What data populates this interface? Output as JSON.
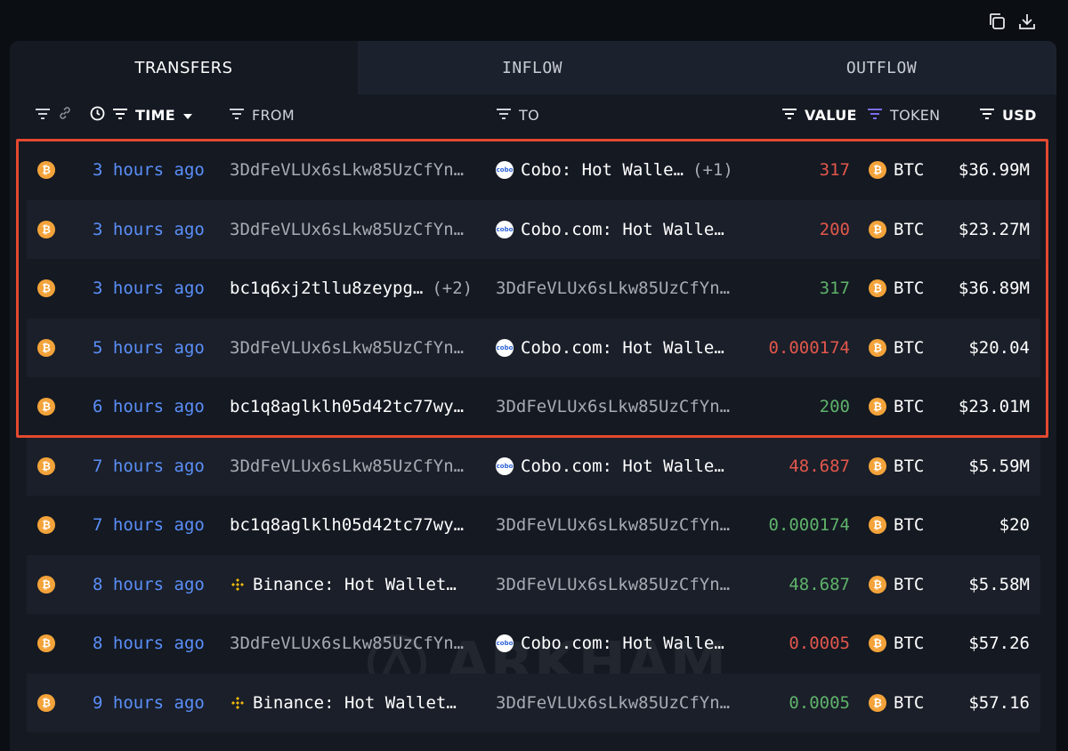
{
  "toolbar": {
    "copy_icon": "copy-icon",
    "download_icon": "download-icon"
  },
  "tabs": [
    {
      "label": "TRANSFERS",
      "active": true
    },
    {
      "label": "INFLOW",
      "active": false
    },
    {
      "label": "OUTFLOW",
      "active": false
    }
  ],
  "columns": {
    "time": "TIME",
    "from": "FROM",
    "to": "TO",
    "value": "VALUE",
    "token": "TOKEN",
    "usd": "USD"
  },
  "rows": [
    {
      "time": "3 hours ago",
      "from": "3DdFeVLUx6sLkw85UzCfYn…",
      "from_type": "address",
      "to": "Cobo: Hot Walle…",
      "to_type": "cobo",
      "to_extra": "(+1)",
      "value": "317",
      "direction": "out",
      "token": "BTC",
      "usd": "$36.99M"
    },
    {
      "time": "3 hours ago",
      "from": "3DdFeVLUx6sLkw85UzCfYn…",
      "from_type": "address",
      "to": "Cobo.com: Hot Walle…",
      "to_type": "cobo",
      "value": "200",
      "direction": "out",
      "token": "BTC",
      "usd": "$23.27M"
    },
    {
      "time": "3 hours ago",
      "from": "bc1q6xj2tllu8zeypg…",
      "from_type": "entity",
      "from_extra": "(+2)",
      "to": "3DdFeVLUx6sLkw85UzCfYn…",
      "to_type": "address",
      "value": "317",
      "direction": "in",
      "token": "BTC",
      "usd": "$36.89M"
    },
    {
      "time": "5 hours ago",
      "from": "3DdFeVLUx6sLkw85UzCfYn…",
      "from_type": "address",
      "to": "Cobo.com: Hot Walle…",
      "to_type": "cobo",
      "value": "0.000174",
      "direction": "out",
      "token": "BTC",
      "usd": "$20.04"
    },
    {
      "time": "6 hours ago",
      "from": "bc1q8aglklh05d42tc77wy…",
      "from_type": "entity",
      "to": "3DdFeVLUx6sLkw85UzCfYn…",
      "to_type": "address",
      "value": "200",
      "direction": "in",
      "token": "BTC",
      "usd": "$23.01M"
    },
    {
      "time": "7 hours ago",
      "from": "3DdFeVLUx6sLkw85UzCfYn…",
      "from_type": "address",
      "to": "Cobo.com: Hot Walle…",
      "to_type": "cobo",
      "value": "48.687",
      "direction": "out",
      "token": "BTC",
      "usd": "$5.59M"
    },
    {
      "time": "7 hours ago",
      "from": "bc1q8aglklh05d42tc77wy…",
      "from_type": "entity",
      "to": "3DdFeVLUx6sLkw85UzCfYn…",
      "to_type": "address",
      "value": "0.000174",
      "direction": "in",
      "token": "BTC",
      "usd": "$20"
    },
    {
      "time": "8 hours ago",
      "from": "Binance: Hot Wallet…",
      "from_type": "binance",
      "to": "3DdFeVLUx6sLkw85UzCfYn…",
      "to_type": "address",
      "value": "48.687",
      "direction": "in",
      "token": "BTC",
      "usd": "$5.58M"
    },
    {
      "time": "8 hours ago",
      "from": "3DdFeVLUx6sLkw85UzCfYn…",
      "from_type": "address",
      "to": "Cobo.com: Hot Walle…",
      "to_type": "cobo",
      "value": "0.0005",
      "direction": "out",
      "token": "BTC",
      "usd": "$57.26"
    },
    {
      "time": "9 hours ago",
      "from": "Binance: Hot Wallet…",
      "from_type": "binance",
      "to": "3DdFeVLUx6sLkw85UzCfYn…",
      "to_type": "address",
      "value": "0.0005",
      "direction": "in",
      "token": "BTC",
      "usd": "$57.16"
    }
  ],
  "icons": {
    "btc_glyph": "₿",
    "cobo_glyph": "cobo"
  },
  "watermark": "ARKHAM",
  "colors": {
    "outflow": "#e2574c",
    "inflow": "#5fb26a",
    "time": "#5b8ff9",
    "btc": "#f3a33a",
    "highlight": "#e4492f"
  }
}
